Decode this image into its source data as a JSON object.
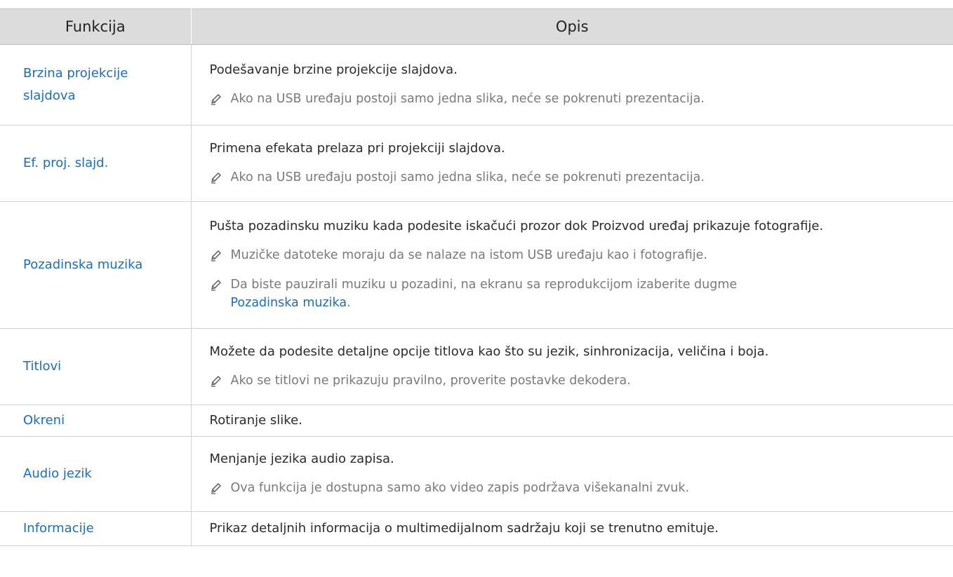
{
  "header": {
    "col1": "Funkcija",
    "col2": "Opis"
  },
  "rows": [
    {
      "name": "Brzina projekcije slajdova",
      "desc": "Podešavanje brzine projekcije slajdova.",
      "notes": [
        "Ako na USB uređaju postoji samo jedna slika, neće se pokrenuti prezentacija."
      ]
    },
    {
      "name": "Ef. proj. slajd.",
      "desc": "Primena efekata prelaza pri projekciji slajdova.",
      "notes": [
        "Ako na USB uređaju postoji samo jedna slika, neće se pokrenuti prezentacija."
      ]
    },
    {
      "name": "Pozadinska muzika",
      "desc": "Pušta pozadinsku muziku kada podesite iskačući prozor dok Proizvod uređaj prikazuje fotografije.",
      "notes": [
        "Muzičke datoteke moraju da se nalaze na istom USB uređaju kao i fotografije.",
        "Da biste pauzirali muziku u pozadini, na ekranu sa reprodukcijom izaberite dugme"
      ],
      "note_link": "Pozadinska muzika",
      "note_end": "."
    },
    {
      "name": "Titlovi",
      "desc": "Možete da podesite detaljne opcije titlova kao što su jezik, sinhronizacija, veličina i boja.",
      "notes": [
        "Ako se titlovi ne prikazuju pravilno, proverite postavke dekodera."
      ]
    },
    {
      "name": "Okreni",
      "desc": "Rotiranje slike.",
      "notes": []
    },
    {
      "name": "Audio jezik",
      "desc": "Menjanje jezika audio zapisa.",
      "notes": [
        "Ova funkcija je dostupna samo ako video zapis podržava višekanalni zvuk."
      ]
    },
    {
      "name": "Informacije",
      "desc": "Prikaz detaljnih informacija o multimedijalnom sadržaju koji se trenutno emituje.",
      "notes": []
    }
  ],
  "icons": {
    "note": "pencil-note-icon"
  },
  "colors": {
    "link": "#1a6dc6",
    "header_bg": "#dcdcdc",
    "note_text": "#7a7a7a"
  }
}
